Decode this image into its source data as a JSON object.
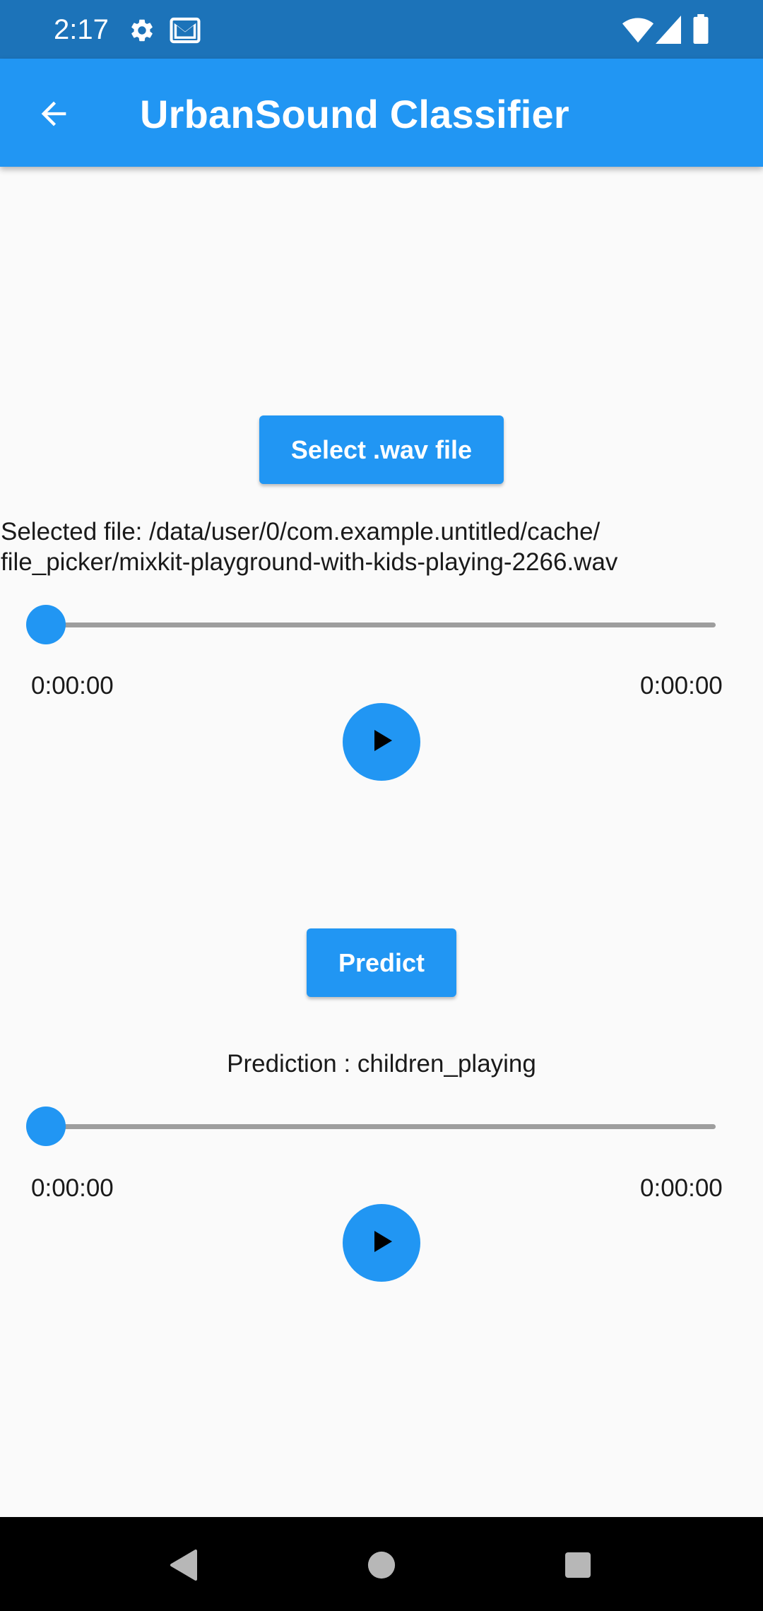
{
  "status_bar": {
    "time": "2:17",
    "left_icons": [
      "gear-icon",
      "gmail-icon"
    ],
    "right_icons": [
      "wifi-icon",
      "signal-icon",
      "battery-icon"
    ]
  },
  "app_bar": {
    "title": "UrbanSound Classifier",
    "back_icon": "arrow-back-icon",
    "color": "#2196f3",
    "status_color": "#1c73b9"
  },
  "file_section": {
    "select_button_label": "Select .wav file",
    "selected_file_line1": "Selected file: /data/user/0/com.example.untitled/cache/",
    "selected_file_line2": "file_picker/mixkit-playground-with-kids-playing-2266.wav",
    "player": {
      "position": "0:00:00",
      "duration": "0:00:00",
      "progress": 0,
      "play_icon": "play-icon"
    }
  },
  "predict_section": {
    "predict_button_label": "Predict",
    "prediction_text": "Prediction : children_playing",
    "player": {
      "position": "0:00:00",
      "duration": "0:00:00",
      "progress": 0,
      "play_icon": "play-icon"
    }
  },
  "nav_bar": {
    "buttons": [
      "back-triangle-icon",
      "home-circle-icon",
      "recents-square-icon"
    ]
  }
}
